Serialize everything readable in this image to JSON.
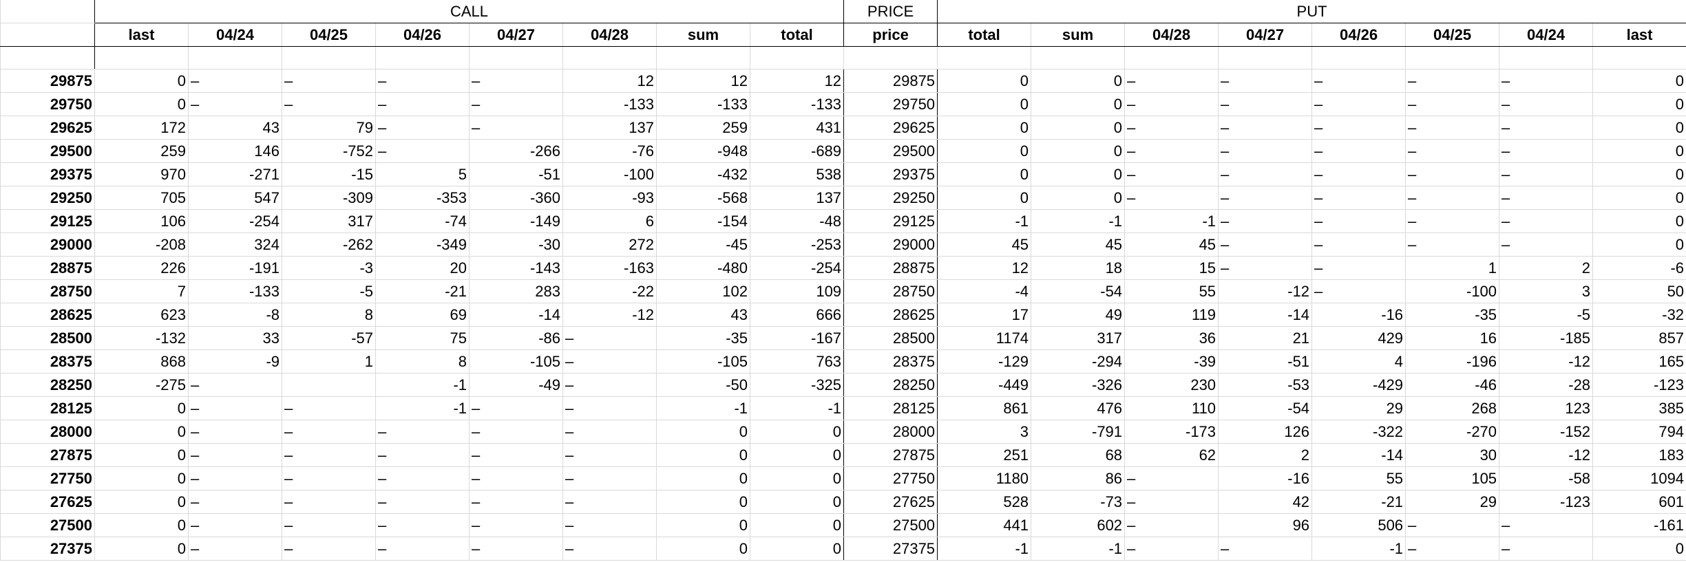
{
  "groups": {
    "call": "CALL",
    "price": "PRICE",
    "put": "PUT"
  },
  "headers": [
    "last",
    "04/24",
    "04/25",
    "04/26",
    "04/27",
    "04/28",
    "sum",
    "total",
    "price",
    "total",
    "sum",
    "04/28",
    "04/27",
    "04/26",
    "04/25",
    "04/24",
    "last"
  ],
  "rows": [
    [
      "29875",
      "0",
      "–",
      "–",
      "–",
      "–",
      "12",
      "12",
      "12",
      "29875",
      "0",
      "0",
      "–",
      "–",
      "–",
      "–",
      "–",
      "0"
    ],
    [
      "29750",
      "0",
      "–",
      "–",
      "–",
      "–",
      "-133",
      "-133",
      "-133",
      "29750",
      "0",
      "0",
      "–",
      "–",
      "–",
      "–",
      "–",
      "0"
    ],
    [
      "29625",
      "172",
      "43",
      "79",
      "–",
      "–",
      "137",
      "259",
      "431",
      "29625",
      "0",
      "0",
      "–",
      "–",
      "–",
      "–",
      "–",
      "0"
    ],
    [
      "29500",
      "259",
      "146",
      "-752",
      "–",
      "-266",
      "-76",
      "-948",
      "-689",
      "29500",
      "0",
      "0",
      "–",
      "–",
      "–",
      "–",
      "–",
      "0"
    ],
    [
      "29375",
      "970",
      "-271",
      "-15",
      "5",
      "-51",
      "-100",
      "-432",
      "538",
      "29375",
      "0",
      "0",
      "–",
      "–",
      "–",
      "–",
      "–",
      "0"
    ],
    [
      "29250",
      "705",
      "547",
      "-309",
      "-353",
      "-360",
      "-93",
      "-568",
      "137",
      "29250",
      "0",
      "0",
      "–",
      "–",
      "–",
      "–",
      "–",
      "0"
    ],
    [
      "29125",
      "106",
      "-254",
      "317",
      "-74",
      "-149",
      "6",
      "-154",
      "-48",
      "29125",
      "-1",
      "-1",
      "-1",
      "–",
      "–",
      "–",
      "–",
      "0"
    ],
    [
      "29000",
      "-208",
      "324",
      "-262",
      "-349",
      "-30",
      "272",
      "-45",
      "-253",
      "29000",
      "45",
      "45",
      "45",
      "–",
      "–",
      "–",
      "–",
      "0"
    ],
    [
      "28875",
      "226",
      "-191",
      "-3",
      "20",
      "-143",
      "-163",
      "-480",
      "-254",
      "28875",
      "12",
      "18",
      "15",
      "–",
      "–",
      "1",
      "2",
      "-6"
    ],
    [
      "28750",
      "7",
      "-133",
      "-5",
      "-21",
      "283",
      "-22",
      "102",
      "109",
      "28750",
      "-4",
      "-54",
      "55",
      "-12",
      "–",
      "-100",
      "3",
      "50"
    ],
    [
      "28625",
      "623",
      "-8",
      "8",
      "69",
      "-14",
      "-12",
      "43",
      "666",
      "28625",
      "17",
      "49",
      "119",
      "-14",
      "-16",
      "-35",
      "-5",
      "-32"
    ],
    [
      "28500",
      "-132",
      "33",
      "-57",
      "75",
      "-86",
      "–",
      "-35",
      "-167",
      "28500",
      "1174",
      "317",
      "36",
      "21",
      "429",
      "16",
      "-185",
      "857"
    ],
    [
      "28375",
      "868",
      "-9",
      "1",
      "8",
      "-105",
      "–",
      "-105",
      "763",
      "28375",
      "-129",
      "-294",
      "-39",
      "-51",
      "4",
      "-196",
      "-12",
      "165"
    ],
    [
      "28250",
      "-275",
      "–",
      "",
      "-1",
      "-49",
      "–",
      "-50",
      "-325",
      "28250",
      "-449",
      "-326",
      "230",
      "-53",
      "-429",
      "-46",
      "-28",
      "-123"
    ],
    [
      "28125",
      "0",
      "–",
      "–",
      "-1",
      "–",
      "–",
      "-1",
      "-1",
      "28125",
      "861",
      "476",
      "110",
      "-54",
      "29",
      "268",
      "123",
      "385"
    ],
    [
      "28000",
      "0",
      "–",
      "–",
      "–",
      "–",
      "–",
      "0",
      "0",
      "28000",
      "3",
      "-791",
      "-173",
      "126",
      "-322",
      "-270",
      "-152",
      "794"
    ],
    [
      "27875",
      "0",
      "–",
      "–",
      "–",
      "–",
      "–",
      "0",
      "0",
      "27875",
      "251",
      "68",
      "62",
      "2",
      "-14",
      "30",
      "-12",
      "183"
    ],
    [
      "27750",
      "0",
      "–",
      "–",
      "–",
      "–",
      "–",
      "0",
      "0",
      "27750",
      "1180",
      "86",
      "–",
      "-16",
      "55",
      "105",
      "-58",
      "1094"
    ],
    [
      "27625",
      "0",
      "–",
      "–",
      "–",
      "–",
      "–",
      "0",
      "0",
      "27625",
      "528",
      "-73",
      "–",
      "42",
      "-21",
      "29",
      "-123",
      "601"
    ],
    [
      "27500",
      "0",
      "–",
      "–",
      "–",
      "–",
      "–",
      "0",
      "0",
      "27500",
      "441",
      "602",
      "–",
      "96",
      "506",
      "–",
      "–",
      "-161"
    ],
    [
      "27375",
      "0",
      "–",
      "–",
      "–",
      "–",
      "–",
      "0",
      "0",
      "27375",
      "-1",
      "-1",
      "–",
      "–",
      "-1",
      "–",
      "–",
      "0"
    ]
  ]
}
